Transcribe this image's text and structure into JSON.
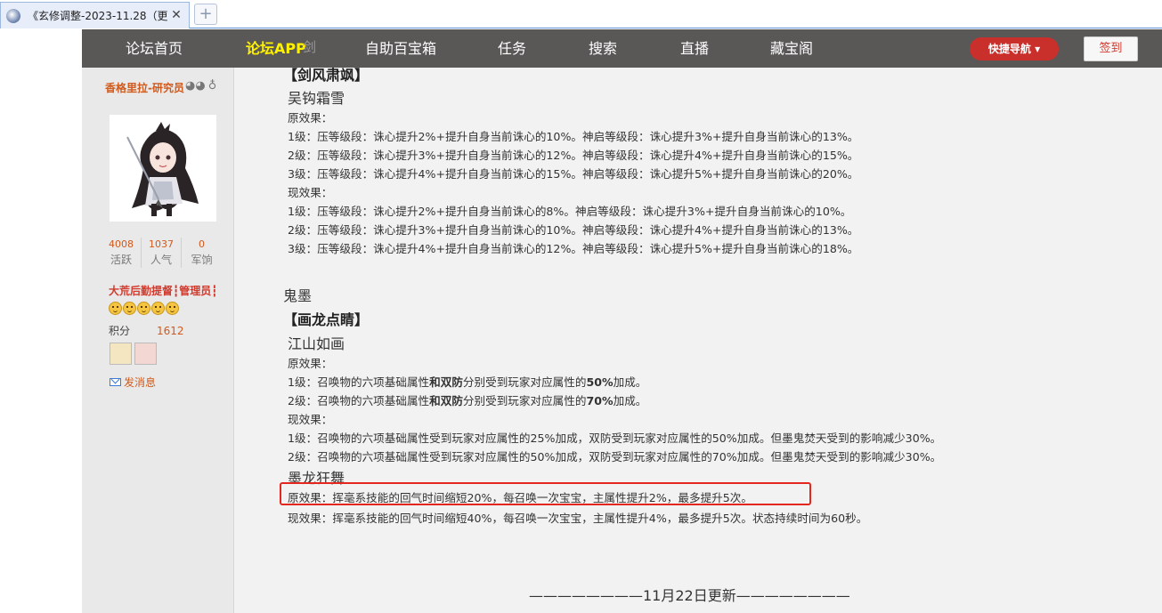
{
  "browser": {
    "tab_title": "《玄修调整-2023-11.28（更",
    "close_glyph": "✕",
    "newtab_glyph": "+"
  },
  "navbar": {
    "items": [
      "论坛首页",
      "论坛APP",
      "自助百宝箱",
      "任务",
      "搜索",
      "直播",
      "藏宝阁"
    ],
    "quick_nav": "快捷导航 ▾",
    "signin": "签到",
    "overlap_text": "剑",
    "accent_color": "#fff200"
  },
  "sidebar": {
    "username": "香格里拉-研究员",
    "stats": [
      {
        "num": "4008",
        "label": "活跃"
      },
      {
        "num": "1037",
        "label": "人气"
      },
      {
        "num": "0",
        "label": "军饷"
      }
    ],
    "title_badge": "大荒后勤提督┇管理员┇",
    "points_label": "积分",
    "points_value": "1612",
    "send_message": "发消息"
  },
  "content": {
    "sec1_skill": "【剑风肃飒】",
    "sec1_sub": "吴钩霜雪",
    "orig_label": "原效果：",
    "cur_label": "现效果：",
    "s1_orig": [
      "1级：压等级段：诛心提升2%+提升自身当前诛心的10%。神启等级段：诛心提升3%+提升自身当前诛心的13%。",
      "2级：压等级段：诛心提升3%+提升自身当前诛心的12%。神启等级段：诛心提升4%+提升自身当前诛心的15%。",
      "3级：压等级段：诛心提升4%+提升自身当前诛心的15%。神启等级段：诛心提升5%+提升自身当前诛心的20%。"
    ],
    "s1_cur": [
      "1级：压等级段：诛心提升2%+提升自身当前诛心的8%。神启等级段：诛心提升3%+提升自身当前诛心的10%。",
      "2级：压等级段：诛心提升3%+提升自身当前诛心的10%。神启等级段：诛心提升4%+提升自身当前诛心的13%。",
      "3级：压等级段：诛心提升4%+提升自身当前诛心的12%。神启等级段：诛心提升5%+提升自身当前诛心的18%。"
    ],
    "sec2_class": "鬼墨",
    "sec2_skill": "【画龙点睛】",
    "sec2_sub": "江山如画",
    "s2_orig": [
      {
        "pre": "1级：召唤物的六项基础属性",
        "b1": "和双防",
        "mid": "分别受到玩家对应属性的",
        "b2": "50%",
        "post": "加成。"
      },
      {
        "pre": "2级：召唤物的六项基础属性",
        "b1": "和双防",
        "mid": "分别受到玩家对应属性的",
        "b2": "70%",
        "post": "加成。"
      }
    ],
    "s2_cur": [
      "1级：召唤物的六项基础属性受到玩家对应属性的25%加成，双防受到玩家对应属性的50%加成。但墨鬼焚天受到的影响减少30%。",
      "2级：召唤物的六项基础属性受到玩家对应属性的50%加成，双防受到玩家对应属性的70%加成。但墨鬼焚天受到的影响减少30%。"
    ],
    "sec3_sub": "墨龙狂舞",
    "s3_orig": "原效果：挥毫系技能的回气时间缩短20%，每召唤一次宝宝，主属性提升2%，最多提升5次。",
    "s3_cur": "现效果：挥毫系技能的回气时间缩短40%，每召唤一次宝宝，主属性提升4%，最多提升5次。状态持续时间为60秒。",
    "divider": "————————11月22日更新————————"
  }
}
